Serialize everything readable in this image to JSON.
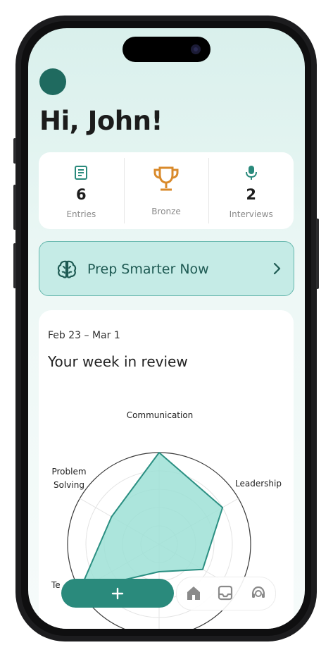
{
  "header": {
    "greeting": "Hi, John!"
  },
  "stats": [
    {
      "icon": "document-icon",
      "value": "6",
      "label": "Entries"
    },
    {
      "icon": "trophy-icon",
      "value": "",
      "label": "Bronze"
    },
    {
      "icon": "microphone-icon",
      "value": "2",
      "label": "Interviews"
    }
  ],
  "prep": {
    "label": "Prep Smarter Now"
  },
  "review": {
    "date_range": "Feb 23 – Mar 1",
    "title": "Your week in review",
    "labels": {
      "communication": "Communication",
      "leadership": "Leadership",
      "problem_solving_1": "Problem",
      "problem_solving_2": "Solving",
      "team_partial": "Te"
    }
  },
  "chart_data": {
    "type": "radar",
    "axes": [
      "Communication",
      "Leadership",
      "",
      "",
      "Te",
      "Problem Solving"
    ],
    "values": [
      1.0,
      0.8,
      0.55,
      0.3,
      1.0,
      0.6
    ],
    "fill_color": "#9de0d6",
    "stroke_color": "#2b8f82"
  },
  "bottom_bar": {
    "add_label": "+"
  },
  "colors": {
    "accent": "#2a8a7c",
    "brand_dark": "#1f6a5f",
    "bronze": "#d98a2b"
  }
}
